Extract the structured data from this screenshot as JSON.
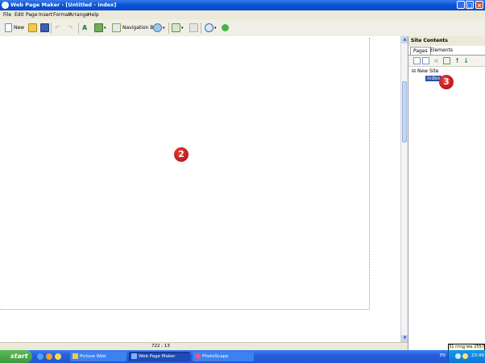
{
  "window": {
    "title": "Web Page Maker - [Untitled - index]"
  },
  "menu": [
    "File",
    "Edit",
    "Page",
    "Insert",
    "Format",
    "Arrange",
    "Help"
  ],
  "toolbar": {
    "new_label": "New",
    "navbar_label": "Navigation Bar"
  },
  "status": {
    "coords": "722 : 13"
  },
  "side_panel": {
    "title": "Site Contents",
    "tabs": [
      "Pages",
      "Elements"
    ],
    "tree": {
      "root": "New Site",
      "child": "index",
      "expander": "⊟"
    }
  },
  "badges": {
    "canvas": "2",
    "panel": "3"
  },
  "taskbar": {
    "start_label": "start",
    "items": [
      "Picture Web",
      "Web Page Maker",
      "PhotoScape"
    ],
    "lang": "EN",
    "clock": "23:49"
  },
  "tooltip": {
    "date": "31 กรกฎาคม 2557"
  },
  "icons": [
    "app-icon",
    "new-icon",
    "open-icon",
    "save-icon",
    "undo-icon",
    "redo-icon",
    "text-icon",
    "image-icon",
    "navbar-icon",
    "form-icon",
    "draw-icon",
    "paste-icon",
    "zoom-icon",
    "preview-icon"
  ],
  "colors": {
    "titlebar": "#0a55d8",
    "badge": "#c41e1e",
    "taskbar": "#245edb",
    "start": "#3a9a3a"
  }
}
